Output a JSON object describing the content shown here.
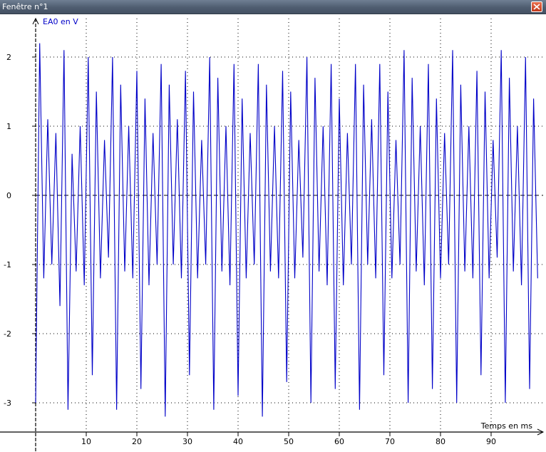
{
  "window": {
    "title": "Fenêtre n°1",
    "close_icon": "close-icon"
  },
  "colors": {
    "titlebar": "#4f5d70",
    "signal": "#0000c8",
    "ylabel": "#0000c8",
    "close_button": "#d2512f"
  },
  "chart_data": {
    "type": "line",
    "ylabel": "EA0 en V",
    "xlabel": "Temps en ms",
    "xlim": [
      -0.3,
      100
    ],
    "ylim": [
      -3.4,
      2.4
    ],
    "x_ticks": [
      10,
      20,
      30,
      40,
      50,
      60,
      70,
      80,
      90
    ],
    "y_ticks": [
      2,
      1,
      0,
      -1,
      -2,
      -3
    ],
    "x_tick_labels": [
      "10",
      "20",
      "30",
      "40",
      "50",
      "60",
      "70",
      "80",
      "90"
    ],
    "y_tick_labels": [
      "2",
      "1",
      "0",
      "-1",
      "-2",
      "-3"
    ],
    "grid": true,
    "series": [
      {
        "color": "#0000c8",
        "description_points": "approx periodic oscillation ~0.8 ms period with beat envelope; peaks near 2.2 V, troughs near -3.2 V",
        "x": [
          0.0,
          0.8,
          1.6,
          2.4,
          3.2,
          4.0,
          4.8,
          5.6,
          6.4,
          7.2,
          8.0,
          8.8,
          9.6,
          10.4,
          11.2,
          12.0,
          12.8,
          13.6,
          14.4,
          15.2,
          16.0,
          16.8,
          17.6,
          18.4,
          19.2,
          20.0,
          20.8,
          21.6,
          22.4,
          23.2,
          24.0,
          24.8,
          25.6,
          26.4,
          27.2,
          28.0,
          28.8,
          29.6,
          30.4,
          31.2,
          32.0,
          32.8,
          33.6,
          34.4,
          35.2,
          36.0,
          36.8,
          37.6,
          38.4,
          39.2,
          40.0,
          40.8,
          41.6,
          42.4,
          43.2,
          44.0,
          44.8,
          45.6,
          46.4,
          47.2,
          48.0,
          48.8,
          49.6,
          50.4,
          51.2,
          52.0,
          52.8,
          53.6,
          54.4,
          55.2,
          56.0,
          56.8,
          57.6,
          58.4,
          59.2,
          60.0,
          60.8,
          61.6,
          62.4,
          63.2,
          64.0,
          64.8,
          65.6,
          66.4,
          67.2,
          68.0,
          68.8,
          69.6,
          70.4,
          71.2,
          72.0,
          72.8,
          73.6,
          74.4,
          75.2,
          76.0,
          76.8,
          77.6,
          78.4,
          79.2,
          80.0,
          80.8,
          81.6,
          82.4,
          83.2,
          84.0,
          84.8,
          85.6,
          86.4,
          87.2,
          88.0,
          88.8,
          89.6,
          90.4,
          91.2,
          92.0,
          92.8,
          93.6,
          94.4,
          95.2,
          96.0,
          96.8,
          97.6,
          98.4,
          99.2
        ],
        "y": [
          -3.0,
          2.2,
          -1.2,
          1.1,
          -1.0,
          0.9,
          -1.6,
          2.1,
          -3.1,
          0.6,
          -1.1,
          1.0,
          -1.3,
          2.0,
          -2.6,
          1.5,
          -1.2,
          0.8,
          -0.9,
          2.0,
          -3.1,
          1.6,
          -1.1,
          1.0,
          -1.2,
          1.8,
          -2.8,
          1.4,
          -1.3,
          0.9,
          -1.0,
          1.9,
          -3.2,
          1.6,
          -1.0,
          1.1,
          -1.2,
          1.8,
          -2.6,
          1.5,
          -1.2,
          0.8,
          -1.0,
          2.0,
          -3.1,
          1.7,
          -1.1,
          1.0,
          -1.3,
          1.9,
          -2.9,
          1.4,
          -1.2,
          0.9,
          -1.0,
          1.9,
          -3.2,
          1.6,
          -1.1,
          1.0,
          -1.2,
          1.8,
          -2.7,
          1.5,
          -1.2,
          0.8,
          -0.9,
          2.0,
          -3.0,
          1.7,
          -1.1,
          1.0,
          -1.3,
          1.9,
          -2.8,
          1.4,
          -1.3,
          0.9,
          -1.0,
          1.9,
          -3.1,
          1.6,
          -1.0,
          1.1,
          -1.2,
          1.9,
          -2.6,
          1.5,
          -1.2,
          0.8,
          -1.0,
          2.1,
          -3.0,
          1.7,
          -1.1,
          1.0,
          -1.3,
          1.9,
          -2.8,
          1.4,
          -1.2,
          0.9,
          -1.0,
          2.1,
          -3.0,
          1.6,
          -1.1,
          1.0,
          -1.2,
          1.8,
          -2.6,
          1.5,
          -1.2,
          0.8,
          -0.9,
          2.1,
          -3.0,
          1.7,
          -1.1,
          1.0,
          -1.3,
          2.0,
          -2.8,
          1.4,
          -1.2
        ]
      }
    ]
  }
}
